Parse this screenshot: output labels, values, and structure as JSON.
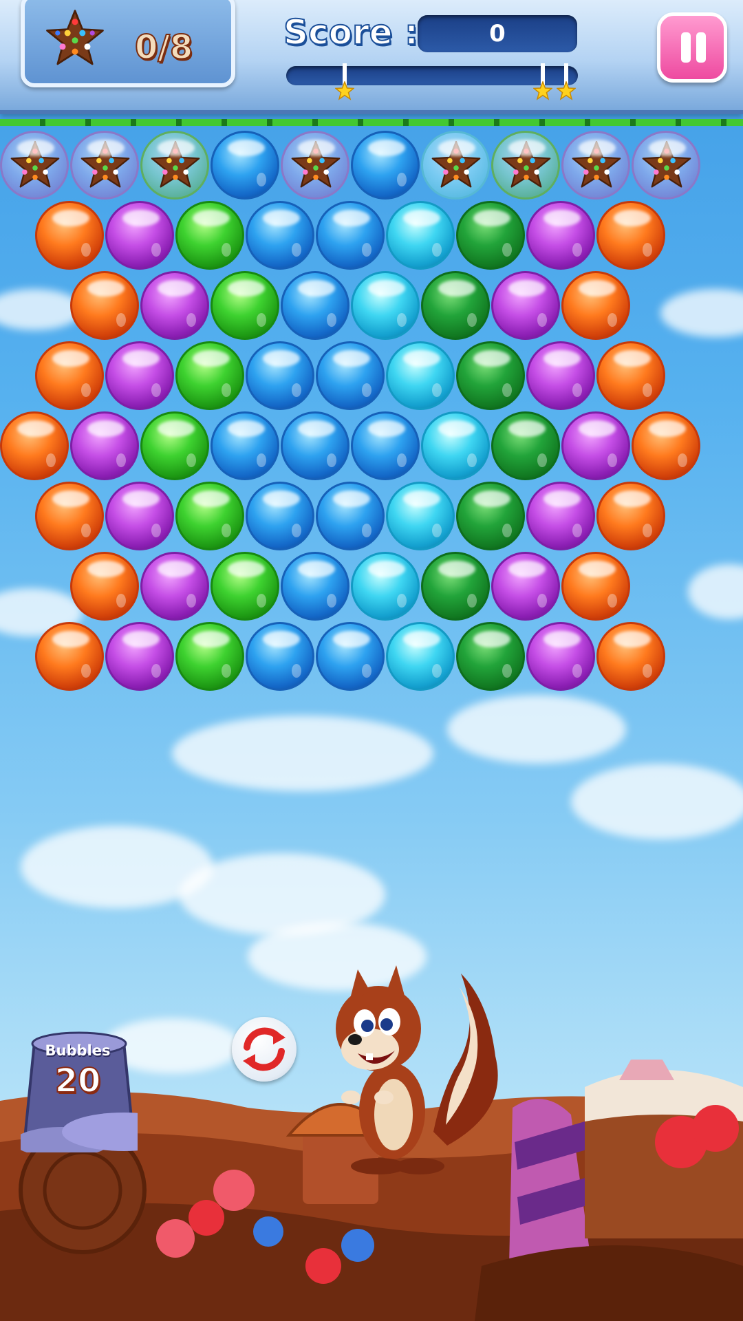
{
  "hud": {
    "goal": {
      "icon": "candy-star-icon",
      "count_text": "0/8"
    },
    "score": {
      "label": "Score :",
      "value": "0"
    },
    "progress": {
      "fill_fraction": 0.0,
      "star_thresholds": [
        0.2,
        0.88,
        0.96
      ],
      "star_icon": "gold-star-icon"
    },
    "pause_icon": "pause-icon"
  },
  "board": {
    "rows": [
      [
        "star",
        "star",
        "star-green",
        "blue",
        "star",
        "blue",
        "star-cyan",
        "star-green",
        "star",
        "star"
      ],
      [
        "orange",
        "purple",
        "green",
        "blue",
        "blue",
        "cyan",
        "dkgreen",
        "purple",
        "orange"
      ],
      [
        "orange",
        "purple",
        "green",
        "blue",
        "cyan",
        "dkgreen",
        "purple",
        "orange"
      ],
      [
        "orange",
        "purple",
        "green",
        "blue",
        "blue",
        "cyan",
        "dkgreen",
        "purple",
        "orange"
      ],
      [
        "orange",
        "purple",
        "green",
        "blue",
        "blue",
        "blue",
        "cyan",
        "dkgreen",
        "purple",
        "orange"
      ],
      [
        "orange",
        "purple",
        "green",
        "blue",
        "blue",
        "cyan",
        "dkgreen",
        "purple",
        "orange"
      ],
      [
        "orange",
        "purple",
        "green",
        "blue",
        "cyan",
        "dkgreen",
        "purple",
        "orange"
      ],
      [
        "orange",
        "purple",
        "green",
        "blue",
        "blue",
        "cyan",
        "dkgreen",
        "purple",
        "orange"
      ]
    ]
  },
  "shooter": {
    "bubbles_label": "Bubbles",
    "bubbles_left": "20",
    "swap_icon": "swap-arrows-icon",
    "character": "squirrel"
  },
  "colors": {
    "hud_blue": "#5f93d2",
    "pause_pink": "#ee4aa0",
    "rail_green": "#43c832"
  }
}
